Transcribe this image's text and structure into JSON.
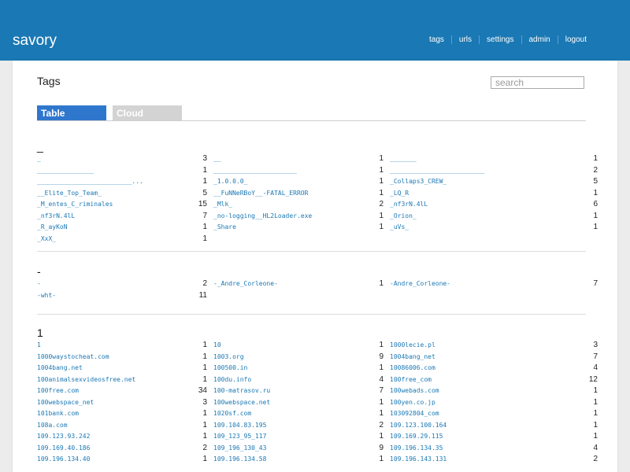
{
  "app": {
    "brand": "savory"
  },
  "nav": [
    "tags",
    "urls",
    "settings",
    "admin",
    "logout"
  ],
  "page": {
    "title": "Tags",
    "search_placeholder": "search"
  },
  "tabs": [
    "Table",
    "Cloud"
  ],
  "groups": [
    {
      "heading": "_",
      "rows": [
        [
          [
            "_",
            "3"
          ],
          [
            "__",
            "1"
          ],
          [
            "_______",
            "1"
          ]
        ],
        [
          [
            "_______________",
            "1"
          ],
          [
            "______________________",
            "1"
          ],
          [
            "_________________________",
            "2"
          ]
        ],
        [
          [
            "_________________________...",
            "1"
          ],
          [
            "_1.0.0.0_",
            "1"
          ],
          [
            "_Collaps3_CREW_",
            "5"
          ]
        ],
        [
          [
            "__Elite_Top_Team_",
            "5"
          ],
          [
            "__FuNNeRBoY__-FATAL_ERROR",
            "1"
          ],
          [
            "_LQ_R",
            "1"
          ]
        ],
        [
          [
            "_M_entes_C_riminales",
            "15"
          ],
          [
            "_Mlk_",
            "2"
          ],
          [
            "_nf3rN.4lL",
            "6"
          ]
        ],
        [
          [
            "_nf3rN.4lL",
            "7"
          ],
          [
            "_no-logging__HL2Loader.exe",
            "1"
          ],
          [
            "_Orion_",
            "1"
          ]
        ],
        [
          [
            "_R_ayKoN",
            "1"
          ],
          [
            "_Share",
            "1"
          ],
          [
            "_uVs_",
            "1"
          ]
        ],
        [
          [
            "_XxX_",
            "1"
          ],
          null,
          null
        ]
      ]
    },
    {
      "heading": "-",
      "rows": [
        [
          [
            "-",
            "2"
          ],
          [
            "-_Andre_Corleone-",
            "1"
          ],
          [
            "-Andre_Corleone-",
            "7"
          ]
        ],
        [
          [
            "-wht-",
            "11"
          ],
          null,
          null
        ]
      ]
    },
    {
      "heading": "1",
      "rows": [
        [
          [
            "1",
            "1"
          ],
          [
            "10",
            "1"
          ],
          [
            "1000lecie.pl",
            "3"
          ]
        ],
        [
          [
            "1000waystocheat.com",
            "1"
          ],
          [
            "1003.org",
            "9"
          ],
          [
            "1004bang_net",
            "7"
          ]
        ],
        [
          [
            "1004bang.net",
            "1"
          ],
          [
            "100500.in",
            "1"
          ],
          [
            "10086006.com",
            "4"
          ]
        ],
        [
          [
            "100animalsexvideosfree.net",
            "1"
          ],
          [
            "100du.info",
            "4"
          ],
          [
            "100free_com",
            "12"
          ]
        ],
        [
          [
            "100free.com",
            "34"
          ],
          [
            "100-matrasov.ru",
            "7"
          ],
          [
            "100webads.com",
            "1"
          ]
        ],
        [
          [
            "100webspace_net",
            "3"
          ],
          [
            "100webspace.net",
            "1"
          ],
          [
            "100yen.co.jp",
            "1"
          ]
        ],
        [
          [
            "101bank.com",
            "1"
          ],
          [
            "1020sf.com",
            "1"
          ],
          [
            "103092804_com",
            "1"
          ]
        ],
        [
          [
            "108a.com",
            "1"
          ],
          [
            "109.104.83.195",
            "2"
          ],
          [
            "109.123.100.164",
            "1"
          ]
        ],
        [
          [
            "109.123.93.242",
            "1"
          ],
          [
            "109_123_95_117",
            "1"
          ],
          [
            "109.169.29.115",
            "1"
          ]
        ],
        [
          [
            "109.169.40.186",
            "2"
          ],
          [
            "109_196_130_43",
            "9"
          ],
          [
            "109.196.134.35",
            "4"
          ]
        ],
        [
          [
            "109.196.134.40",
            "1"
          ],
          [
            "109.196.134.58",
            "1"
          ],
          [
            "109.196.143.131",
            "2"
          ]
        ]
      ]
    }
  ]
}
